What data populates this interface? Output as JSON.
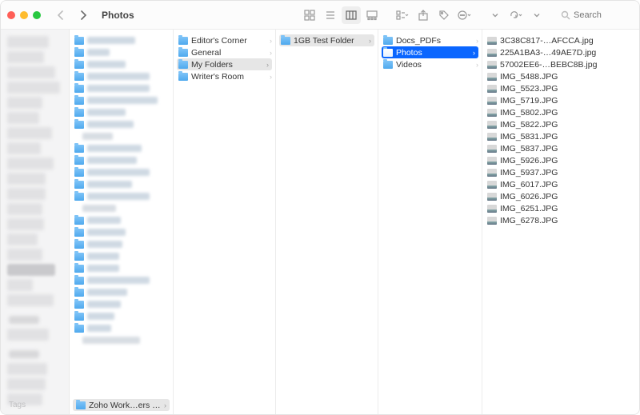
{
  "window": {
    "title": "Photos"
  },
  "toolbar": {
    "view_modes": [
      "icon-view",
      "list-view",
      "column-view",
      "gallery-view"
    ],
    "search_placeholder": "Search"
  },
  "sidebar": {
    "tags_label": "Tags"
  },
  "columns": {
    "col0_pathchip": "Zoho Work…ers United)",
    "col1": [
      {
        "label": "Editor's Corner"
      },
      {
        "label": "General"
      },
      {
        "label": "My Folders",
        "selected": true
      },
      {
        "label": "Writer's Room"
      }
    ],
    "col2": [
      {
        "label": "1GB Test Folder",
        "selected": true
      }
    ],
    "col3": [
      {
        "label": "Docs_PDFs"
      },
      {
        "label": "Photos",
        "selected": true
      },
      {
        "label": "Videos"
      }
    ],
    "col4": [
      {
        "label": "3C38C817-…AFCCA.jpg"
      },
      {
        "label": "225A1BA3-…49AE7D.jpg"
      },
      {
        "label": "57002EE6-…BEBC8B.jpg"
      },
      {
        "label": "IMG_5488.JPG"
      },
      {
        "label": "IMG_5523.JPG"
      },
      {
        "label": "IMG_5719.JPG"
      },
      {
        "label": "IMG_5802.JPG"
      },
      {
        "label": "IMG_5822.JPG"
      },
      {
        "label": "IMG_5831.JPG"
      },
      {
        "label": "IMG_5837.JPG"
      },
      {
        "label": "IMG_5926.JPG"
      },
      {
        "label": "IMG_5937.JPG"
      },
      {
        "label": "IMG_6017.JPG"
      },
      {
        "label": "IMG_6026.JPG"
      },
      {
        "label": "IMG_6251.JPG"
      },
      {
        "label": "IMG_6278.JPG"
      }
    ]
  }
}
